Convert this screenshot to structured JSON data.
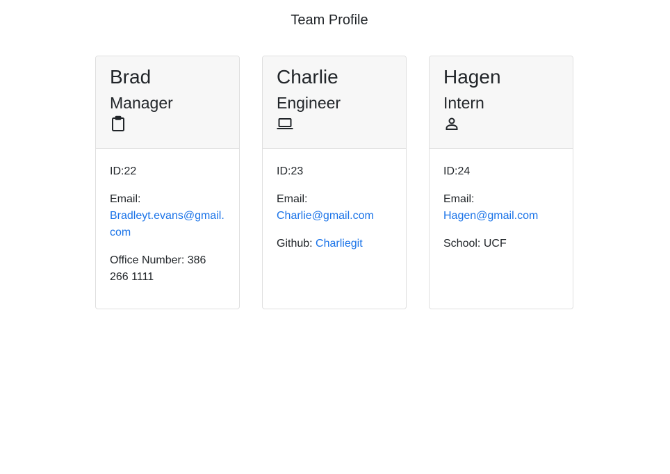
{
  "page": {
    "title": "Team Profile"
  },
  "cards": [
    {
      "name": "Brad",
      "role": "Manager",
      "role_icon": "clipboard-icon",
      "id_text": "ID:22",
      "email_label": "Email:",
      "email": "Bradleyt.evans@gmail.com",
      "extra_label": "Office Number:",
      "extra_value": "386 266 1111"
    },
    {
      "name": "Charlie",
      "role": "Engineer",
      "role_icon": "laptop-icon",
      "id_text": "ID:23",
      "email_label": "Email:",
      "email": "Charlie@gmail.com",
      "extra_label": "Github:",
      "extra_value": "Charliegit"
    },
    {
      "name": "Hagen",
      "role": "Intern",
      "role_icon": "person-icon",
      "id_text": "ID:24",
      "email_label": "Email:",
      "email": "Hagen@gmail.com",
      "extra_label": "School:",
      "extra_value": "UCF"
    }
  ],
  "colors": {
    "link": "#1a73e8",
    "header_bg": "#f7f7f7",
    "border": "#dfdfdf",
    "text": "#212529"
  }
}
